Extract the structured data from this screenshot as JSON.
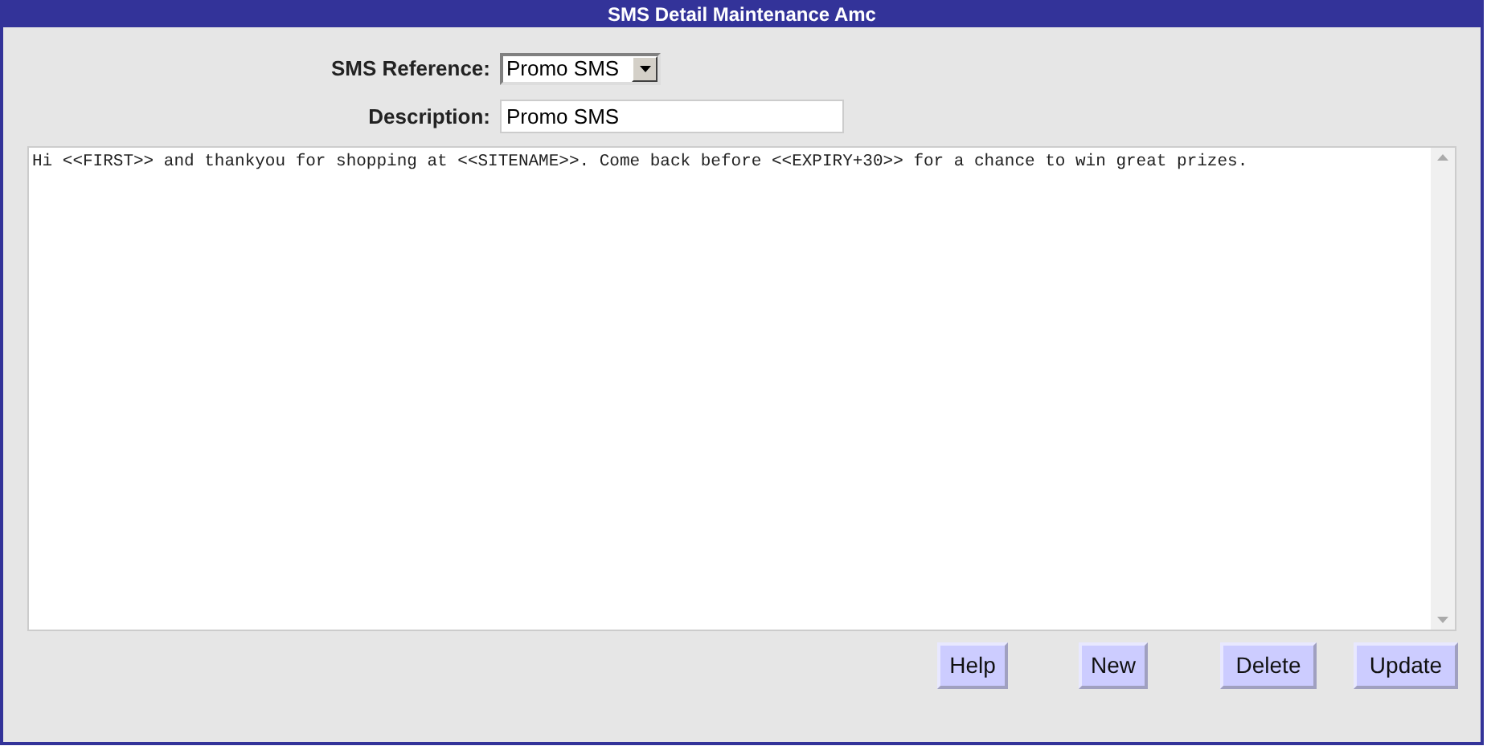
{
  "window": {
    "title": "SMS Detail Maintenance Amc"
  },
  "form": {
    "fields": [
      {
        "kind": "select",
        "label": "SMS Reference:",
        "value": "Promo SMS"
      },
      {
        "kind": "text",
        "label": "Description:",
        "value": "Promo SMS"
      }
    ]
  },
  "message": {
    "value": "Hi <<FIRST>> and thankyou for shopping at <<SITENAME>>. Come back before <<EXPIRY+30>> for a chance to win great prizes."
  },
  "buttons": [
    "Help",
    "New",
    "Delete",
    "Update"
  ]
}
